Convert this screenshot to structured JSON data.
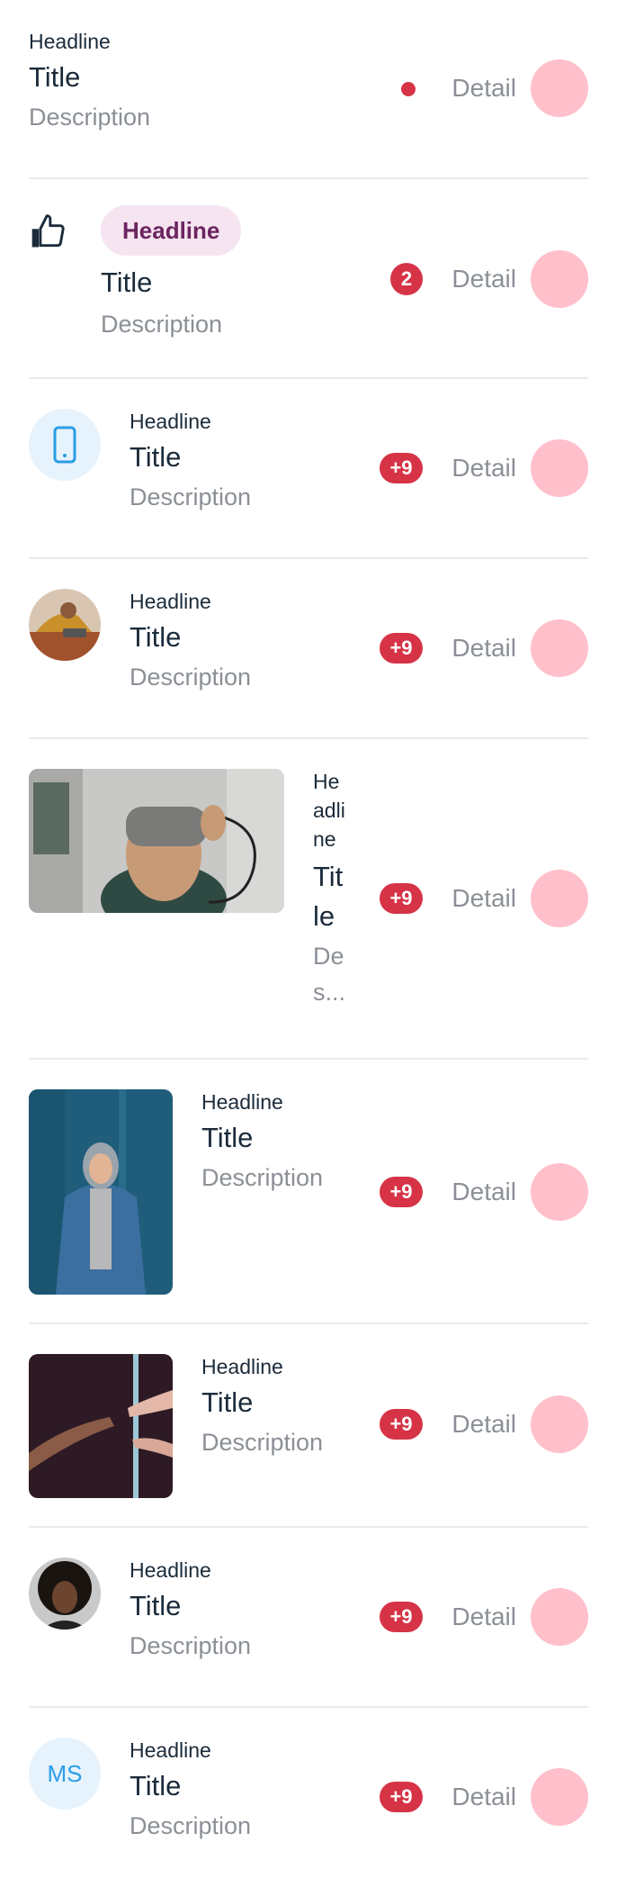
{
  "items": [
    {
      "headline": "Headline",
      "title": "Title",
      "description": "Description",
      "detail": "Detail",
      "badge": ""
    },
    {
      "headline": "Headline",
      "title": "Title",
      "description": "Description",
      "detail": "Detail",
      "badge": "2"
    },
    {
      "headline": "Headline",
      "title": "Title",
      "description": "Description",
      "detail": "Detail",
      "badge": "+9"
    },
    {
      "headline": "Headline",
      "title": "Title",
      "description": "Description",
      "detail": "Detail",
      "badge": "+9"
    },
    {
      "headline": "He adli ne",
      "title": "Tit le",
      "description": "De s...",
      "detail": "Detail",
      "badge": "+9"
    },
    {
      "headline": "Headline",
      "title": "Title",
      "description": "Description",
      "detail": "Detail",
      "badge": "+9"
    },
    {
      "headline": "Headline",
      "title": "Title",
      "description": "Description",
      "detail": "Detail",
      "badge": "+9"
    },
    {
      "headline": "Headline",
      "title": "Title",
      "description": "Description",
      "detail": "Detail",
      "badge": "+9"
    },
    {
      "headline": "Headline",
      "title": "Title",
      "description": "Description",
      "detail": "Detail",
      "badge": "+9",
      "initials": "MS"
    }
  ],
  "colors": {
    "badge": "#d63347",
    "trailing_circle": "#ffc0cb",
    "chip_bg": "#f6e4f1",
    "chip_text": "#6b2560",
    "icon_bg": "#e6f3fd",
    "icon_fg": "#2a9ee6"
  },
  "icons": [
    "thumbs-up-icon",
    "phone-icon"
  ]
}
